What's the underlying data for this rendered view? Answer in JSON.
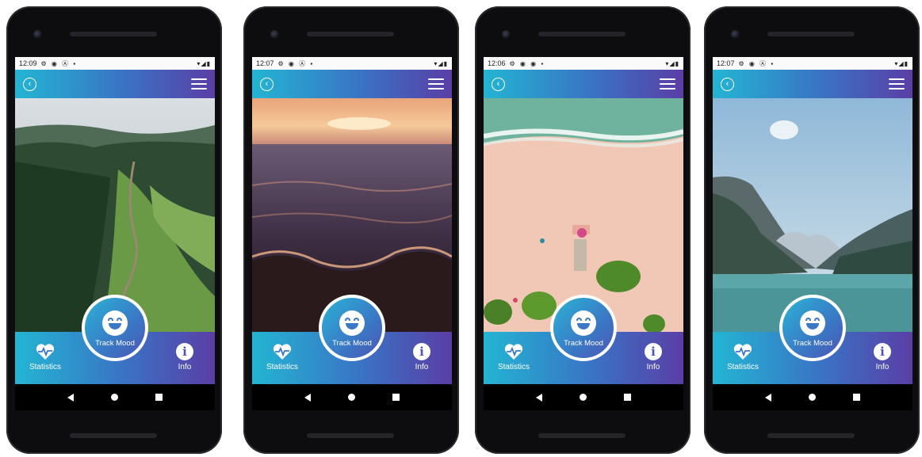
{
  "screens": [
    {
      "status_time": "12:09",
      "status_icons": "⚙ ◉ Ⓐ ▪",
      "status_right": "▾◢▮",
      "track_mood_label": "Track Mood",
      "statistics_label": "Statistics",
      "info_label": "Info",
      "info_glyph": "i",
      "back_glyph": "‹",
      "background": "mountain-trail"
    },
    {
      "status_time": "12:07",
      "status_icons": "⚙ ◉ Ⓐ ▪",
      "status_right": "▾◢▮",
      "track_mood_label": "Track Mood",
      "statistics_label": "Statistics",
      "info_label": "Info",
      "info_glyph": "i",
      "back_glyph": "‹",
      "background": "ocean-sunset"
    },
    {
      "status_time": "12:06",
      "status_icons": "⚙ ◉ ◉ ▪",
      "status_right": "▾◢▮",
      "track_mood_label": "Track Mood",
      "statistics_label": "Statistics",
      "info_label": "Info",
      "info_glyph": "i",
      "back_glyph": "‹",
      "background": "beach-aerial"
    },
    {
      "status_time": "12:07",
      "status_icons": "⚙ ◉ Ⓐ ▪",
      "status_right": "▾◢▮",
      "track_mood_label": "Track Mood",
      "statistics_label": "Statistics",
      "info_label": "Info",
      "info_glyph": "i",
      "back_glyph": "‹",
      "background": "mountain-lake"
    }
  ],
  "colors": {
    "gradient_start": "#23b5d3",
    "gradient_mid": "#3a72c4",
    "gradient_end": "#5a3ea6"
  }
}
